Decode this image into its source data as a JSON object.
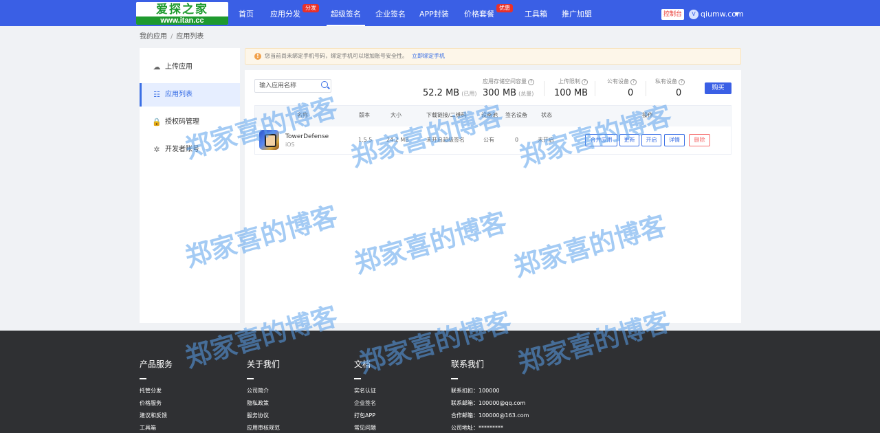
{
  "header": {
    "logo": {
      "main": "爱探之家",
      "url_text": "www.itan.cc"
    },
    "nav": [
      {
        "label": "首页"
      },
      {
        "label": "应用分发",
        "badge": "分发"
      },
      {
        "label": "超级签名",
        "active": true
      },
      {
        "label": "企业签名"
      },
      {
        "label": "APP封装"
      },
      {
        "label": "价格套餐",
        "badge": "优惠"
      },
      {
        "label": "工具箱"
      },
      {
        "label": "推广加盟"
      }
    ],
    "console_label": "控制台",
    "user": {
      "avatar": "V",
      "name": "qiumw.com",
      "caret": "▼"
    }
  },
  "breadcrumb": {
    "root": "我的应用",
    "sep": "/",
    "current": "应用列表"
  },
  "sidebar": {
    "items": [
      {
        "label": "上传应用",
        "icon": "☁"
      },
      {
        "label": "应用列表",
        "icon": "☷",
        "active": true
      },
      {
        "label": "授权码管理",
        "icon": "🔒"
      },
      {
        "label": "开发者账号",
        "icon": "✲"
      }
    ]
  },
  "notice": {
    "icon": "!",
    "text": "您当前尚未绑定手机号码，绑定手机可以增加账号安全性。",
    "link": "立即绑定手机"
  },
  "search": {
    "placeholder": "输入应用名称"
  },
  "stats": {
    "storage": {
      "label": "应用存储空间容量",
      "used": "52.2 MB",
      "used_tag": "(已用)",
      "total": "300 MB",
      "total_tag": "(总量)"
    },
    "upload_limit": {
      "label": "上传限制",
      "value": "100 MB"
    },
    "public_devices": {
      "label": "公有设备",
      "value": "0"
    },
    "private_devices": {
      "label": "私有设备",
      "value": "0"
    },
    "help_glyph": "?",
    "buy_label": "购买"
  },
  "table": {
    "headers": [
      "名称",
      "版本",
      "大小",
      "下载链接/二维码",
      "设备池",
      "签名设备",
      "状态",
      "操作"
    ],
    "rows": [
      {
        "name": "TowerDefense",
        "platform": "iOS",
        "version": "1.5.5",
        "size": "24.2 MB",
        "link_status": "未开启超级签名",
        "pool": "公有",
        "signed": "0",
        "status": "未开启",
        "ops": [
          "合并应用",
          "更新",
          "开启",
          "详情",
          "删除"
        ]
      }
    ]
  },
  "watermark": "郑家喜的博客",
  "footer": {
    "columns": [
      {
        "title": "产品服务",
        "links": [
          "托管分发",
          "价格服务",
          "建议和反馈",
          "工具箱"
        ]
      },
      {
        "title": "关于我们",
        "links": [
          "公司简介",
          "隐私政策",
          "服务协议",
          "应用审核规范"
        ]
      },
      {
        "title": "文档",
        "links": [
          "实名认证",
          "企业签名",
          "打包APP",
          "常见问题"
        ]
      },
      {
        "title": "联系我们",
        "links": [
          "联系扣扣：100000",
          "联系邮箱：100000@qq.com",
          "合作邮箱：100000@163.com",
          "公司地址：*********"
        ]
      }
    ]
  }
}
